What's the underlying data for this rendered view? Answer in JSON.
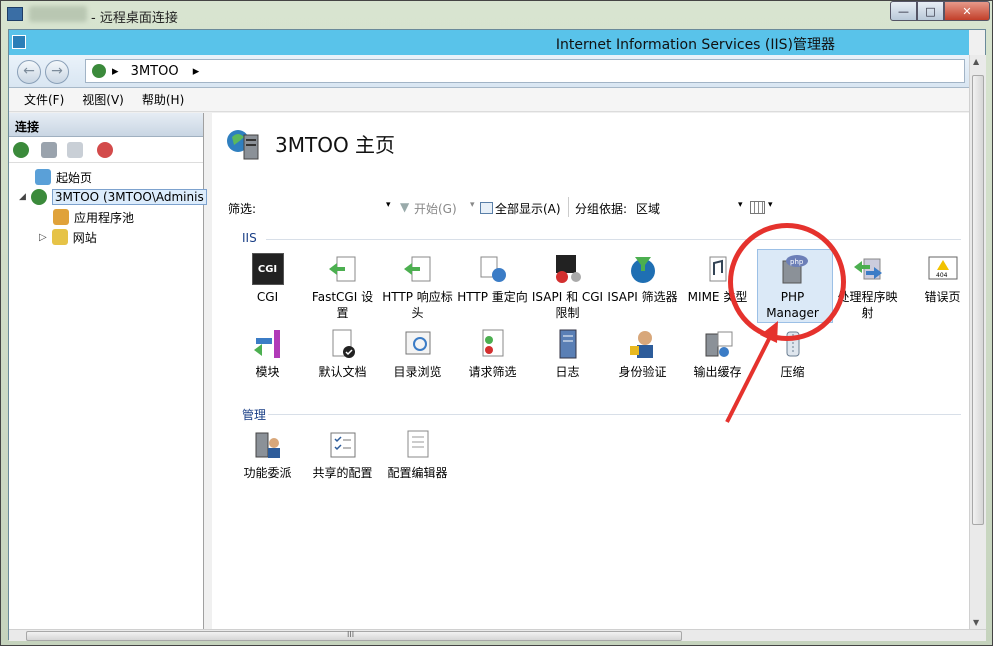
{
  "rdp": {
    "title": "- 远程桌面连接",
    "controls": {
      "min": "—",
      "max": "□",
      "close": "✕"
    }
  },
  "app": {
    "title": "Internet Information Services (IIS)管理器"
  },
  "address": {
    "path": "3MTOO",
    "sep1": "▸",
    "sep2": "▸"
  },
  "menu": {
    "file": "文件(F)",
    "view": "视图(V)",
    "help": "帮助(H)"
  },
  "connections": {
    "header": "连接",
    "tree": {
      "start": "起始页",
      "server": "3MTOO (3MTOO\\Adminis",
      "apppools": "应用程序池",
      "sites": "网站",
      "expand_server": "◢",
      "expand_sites": "▷"
    }
  },
  "page": {
    "title": "3MTOO 主页"
  },
  "filter": {
    "label": "筛选:",
    "start": "开始(G)",
    "showall": "全部显示(A)",
    "groupby_label": "分组依据:",
    "groupby_value": "区域"
  },
  "sections": {
    "iis": "IIS",
    "manage": "管理"
  },
  "iis_icons": [
    {
      "l1": "CGI",
      "l2": ""
    },
    {
      "l1": "FastCGI 设",
      "l2": "置"
    },
    {
      "l1": "HTTP 响应标",
      "l2": "头"
    },
    {
      "l1": "HTTP 重定向",
      "l2": ""
    },
    {
      "l1": "ISAPI 和 CGI",
      "l2": "限制"
    },
    {
      "l1": "ISAPI 筛选器",
      "l2": ""
    },
    {
      "l1": "MIME 类型",
      "l2": ""
    },
    {
      "l1": "PHP",
      "l2": "Manager"
    },
    {
      "l1": "处理程序映",
      "l2": "射"
    },
    {
      "l1": "错误页",
      "l2": ""
    },
    {
      "l1": "模块",
      "l2": ""
    },
    {
      "l1": "默认文档",
      "l2": ""
    },
    {
      "l1": "目录浏览",
      "l2": ""
    },
    {
      "l1": "请求筛选",
      "l2": ""
    },
    {
      "l1": "日志",
      "l2": ""
    },
    {
      "l1": "身份验证",
      "l2": ""
    },
    {
      "l1": "输出缓存",
      "l2": ""
    },
    {
      "l1": "压缩",
      "l2": ""
    }
  ],
  "manage_icons": [
    {
      "l1": "功能委派"
    },
    {
      "l1": "共享的配置"
    },
    {
      "l1": "配置编辑器"
    }
  ],
  "icon_glyphs": {
    "cgi": "CGI",
    "php": "php",
    "err": "404"
  },
  "scroll": {
    "grip": "III"
  },
  "colors": {
    "titlebar": "#59c3ea",
    "annotation": "#e5322d",
    "selected": "#dbe9f7"
  }
}
